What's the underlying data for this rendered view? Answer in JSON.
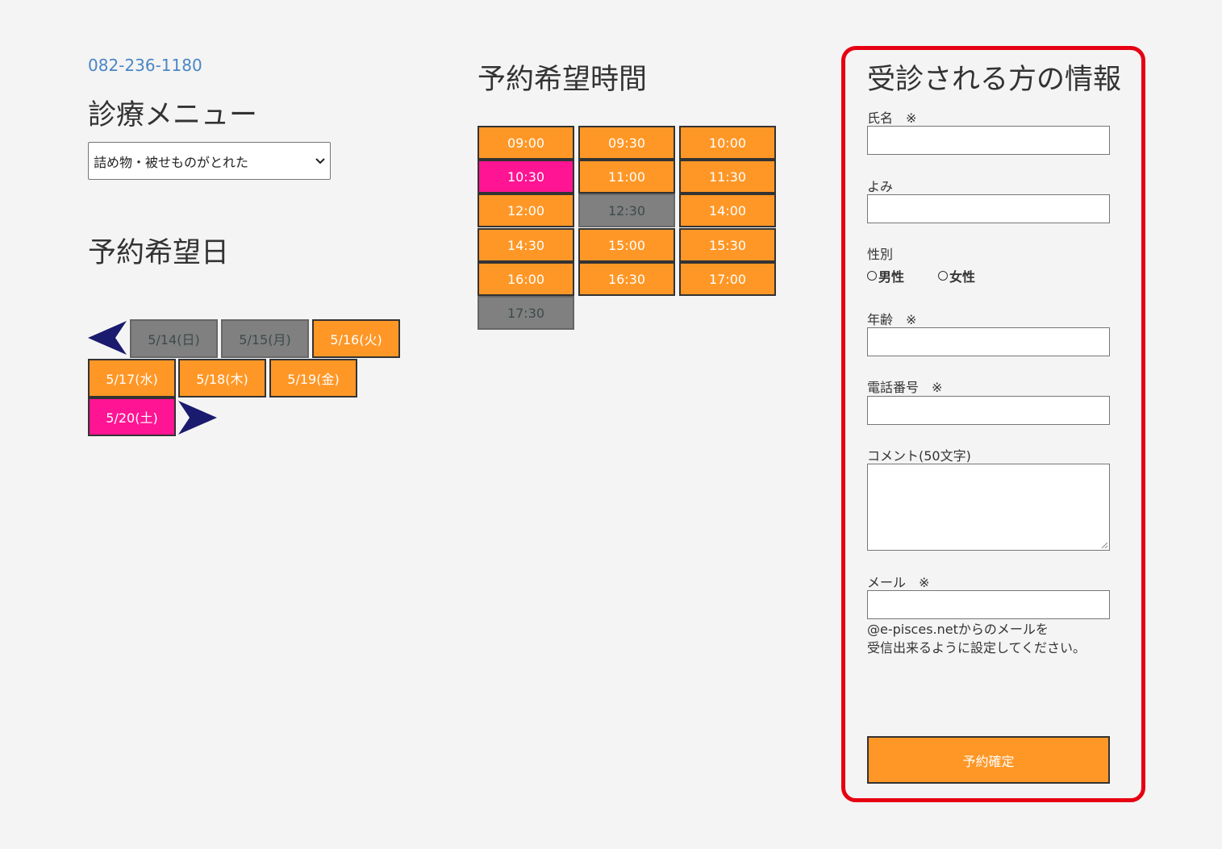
{
  "phone": "082-236-1180",
  "menu": {
    "heading": "診療メニュー",
    "selected": "詰め物・被せものがとれた"
  },
  "date": {
    "heading": "予約希望日",
    "days": [
      {
        "label": "5/14(日)",
        "state": "closed"
      },
      {
        "label": "5/15(月)",
        "state": "closed"
      },
      {
        "label": "5/16(火)",
        "state": "open"
      },
      {
        "label": "5/17(水)",
        "state": "open"
      },
      {
        "label": "5/18(木)",
        "state": "open"
      },
      {
        "label": "5/19(金)",
        "state": "open"
      },
      {
        "label": "5/20(土)",
        "state": "selected"
      }
    ]
  },
  "time": {
    "heading": "予約希望時間",
    "slots": [
      {
        "label": "09:00",
        "state": "open"
      },
      {
        "label": "09:30",
        "state": "open"
      },
      {
        "label": "10:00",
        "state": "open"
      },
      {
        "label": "10:30",
        "state": "selected"
      },
      {
        "label": "11:00",
        "state": "open"
      },
      {
        "label": "11:30",
        "state": "open"
      },
      {
        "label": "12:00",
        "state": "open"
      },
      {
        "label": "12:30",
        "state": "closed"
      },
      {
        "label": "14:00",
        "state": "open"
      },
      {
        "label": "14:30",
        "state": "open"
      },
      {
        "label": "15:00",
        "state": "open"
      },
      {
        "label": "15:30",
        "state": "open"
      },
      {
        "label": "16:00",
        "state": "open"
      },
      {
        "label": "16:30",
        "state": "open"
      },
      {
        "label": "17:00",
        "state": "open"
      },
      {
        "label": "17:30",
        "state": "closed"
      }
    ]
  },
  "form": {
    "heading": "受診される方の情報",
    "name_label": "氏名　※",
    "yomi_label": "よみ",
    "gender_label": "性別",
    "gender_male": "男性",
    "gender_female": "女性",
    "age_label": "年齢　※",
    "phone_label": "電話番号　※",
    "comment_label": "コメント(50文字)",
    "mail_label": "メール　※",
    "mail_note_1": "@e-pisces.netからのメールを",
    "mail_note_2": "受信出来るように設定してください。",
    "submit_label": "予約確定"
  },
  "colors": {
    "open": "#ff9726",
    "selected": "#ff1493",
    "closed": "#808080",
    "panel_border": "#e60012",
    "arrow": "#1a1a6e",
    "phone_link": "#4a86c5"
  }
}
